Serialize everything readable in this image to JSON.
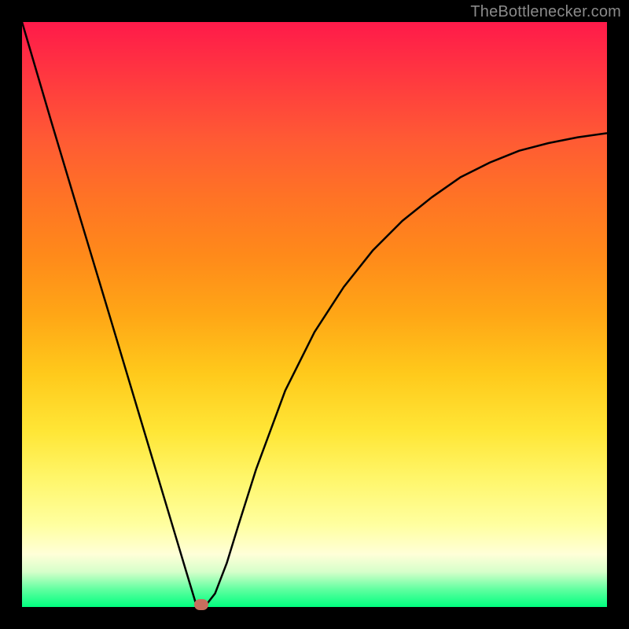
{
  "watermark": "TheBottlenecker.com",
  "chart_data": {
    "type": "line",
    "title": "",
    "xlabel": "",
    "ylabel": "",
    "xlim": [
      0,
      1
    ],
    "ylim": [
      0,
      1
    ],
    "series": [
      {
        "name": "curve",
        "x": [
          0.0,
          0.05,
          0.1,
          0.15,
          0.2,
          0.23,
          0.26,
          0.28,
          0.296,
          0.3,
          0.312,
          0.33,
          0.35,
          0.37,
          0.4,
          0.45,
          0.5,
          0.55,
          0.6,
          0.65,
          0.7,
          0.75,
          0.8,
          0.85,
          0.9,
          0.95,
          1.0
        ],
        "y": [
          1.0,
          0.83,
          0.663,
          0.497,
          0.33,
          0.23,
          0.13,
          0.063,
          0.01,
          0.0,
          0.0,
          0.023,
          0.075,
          0.14,
          0.235,
          0.37,
          0.47,
          0.547,
          0.61,
          0.66,
          0.7,
          0.735,
          0.76,
          0.78,
          0.793,
          0.803,
          0.81
        ]
      }
    ],
    "min_marker": {
      "x": 0.306,
      "y": 0.0
    },
    "gradient_stops": [
      {
        "pos": 0.0,
        "color": "#ff1a4a"
      },
      {
        "pos": 0.5,
        "color": "#ffa616"
      },
      {
        "pos": 0.78,
        "color": "#fff66a"
      },
      {
        "pos": 1.0,
        "color": "#00ff7f"
      }
    ]
  }
}
